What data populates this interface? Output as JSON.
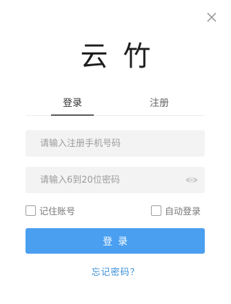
{
  "app": {
    "logo_text": "云竹"
  },
  "tabs": [
    {
      "label": "登录",
      "active": true
    },
    {
      "label": "注册",
      "active": false
    }
  ],
  "form": {
    "phone_placeholder": "请输入注册手机号码",
    "phone_value": "",
    "password_placeholder": "请输入6到20位密码",
    "password_value": "",
    "remember_label": "记住账号",
    "remember_checked": false,
    "autologin_label": "自动登录",
    "autologin_checked": false,
    "login_label": "登录",
    "forgot_label": "忘记密码？"
  },
  "icons": {
    "close": "close-icon",
    "password_visibility": "eye-icon"
  },
  "colors": {
    "primary": "#4a9ff0",
    "link": "#3b8fd6",
    "input_bg": "#f3f3f3",
    "placeholder": "#9c9c9c",
    "tab_active_underline": "#555555"
  }
}
